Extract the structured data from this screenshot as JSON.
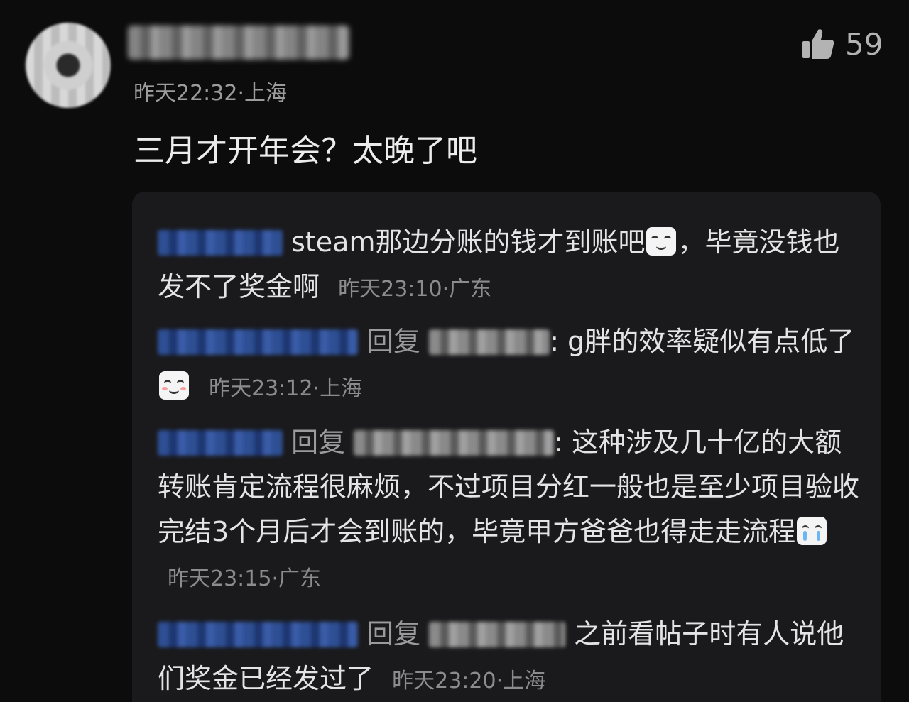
{
  "comment": {
    "time": "昨天22:32",
    "location": "上海",
    "text": "三月才开年会？太晚了吧",
    "likes": "59"
  },
  "replies": [
    {
      "text": "steam那边分账的钱才到账吧",
      "emoji": "smirk-emoji",
      "text2": "，毕竟没钱也发不了奖金啊",
      "time": "昨天23:10",
      "location": "广东"
    },
    {
      "reply_word": "回复",
      "text": "g胖的效率疑似有点低了",
      "emoji": "blush-emoji",
      "time": "昨天23:12",
      "location": "上海"
    },
    {
      "reply_word": "回复",
      "text": "这种涉及几十亿的大额转账肯定流程很麻烦，不过项目分红一般也是至少项目验收完结3个月后才会到账的，毕竟甲方爸爸也得走走流程",
      "emoji": "crying-emoji",
      "time": "昨天23:15",
      "location": "广东"
    },
    {
      "reply_word": "回复",
      "text": "之前看帖子时有人说他们奖金已经发过了",
      "time": "昨天23:20",
      "location": "上海"
    }
  ],
  "colors": {
    "background": "#0c0c0c",
    "reply_panel": "#1a1a1c",
    "meta_text": "#9b9b9b"
  }
}
